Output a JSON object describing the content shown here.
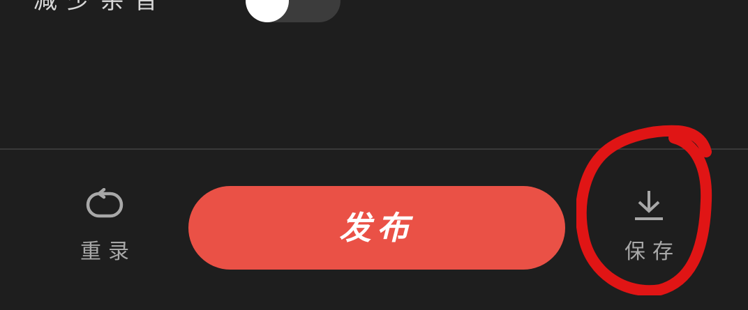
{
  "settings": {
    "row_label": "减少杂音",
    "toggle_state": "on"
  },
  "actions": {
    "retake_label": "重录",
    "publish_label": "发布",
    "save_label": "保存"
  },
  "icons": {
    "retake": "retake-icon",
    "save": "download-icon"
  },
  "colors": {
    "background": "#1e1e1e",
    "publish": "#ea5146",
    "annotation": "#e01515"
  }
}
